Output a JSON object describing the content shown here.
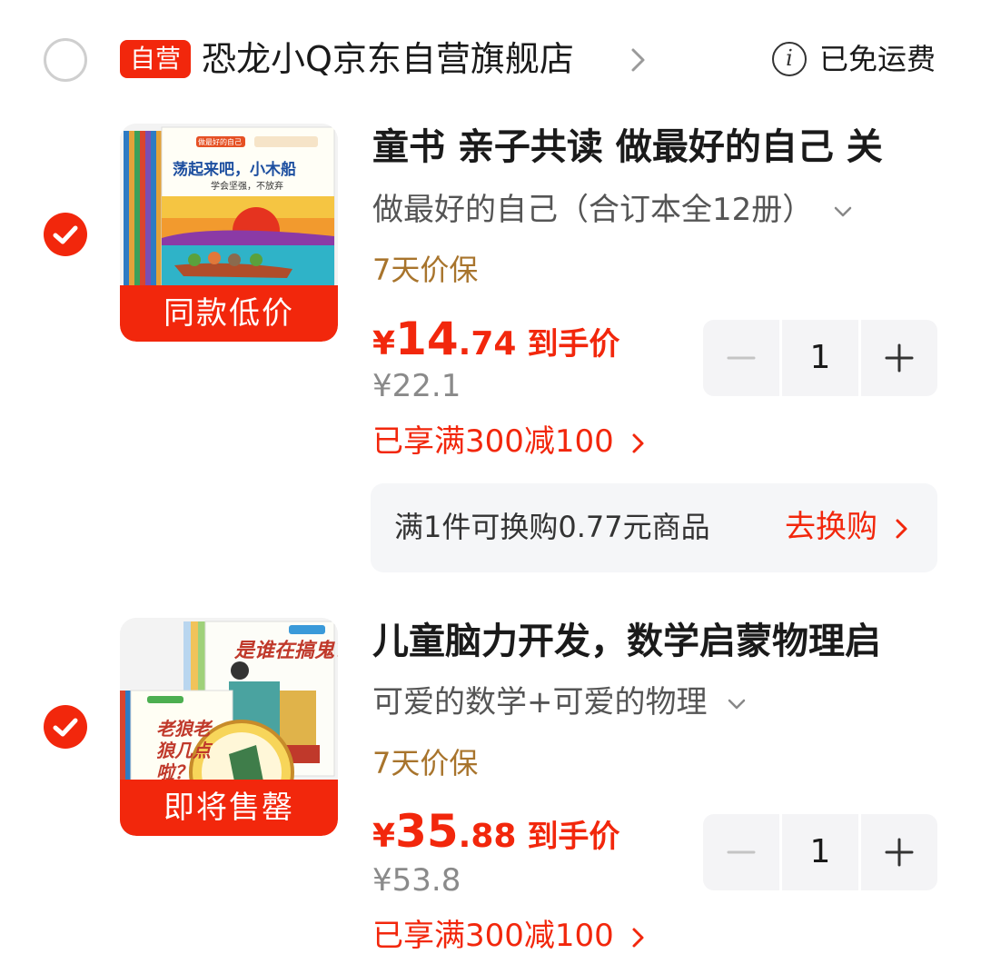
{
  "store": {
    "badge": "自营",
    "name": "恐龙小Q京东自营旗舰店",
    "free_shipping": "已免运费",
    "info_icon": "i"
  },
  "items": [
    {
      "title": "童书 亲子共读 做最好的自己 关",
      "spec": "做最好的自己（合订本全12册）",
      "guarantee": "7天价保",
      "price_symbol": "¥",
      "price_int": "14",
      "price_dec": ".74",
      "price_label": "到手价",
      "original_price": "¥22.1",
      "promo": "已享满300减100",
      "quantity": "1",
      "image_tag": "同款低价",
      "cover_title": "荡起来吧，小木船",
      "cover_subtitle": "学会坚强，不放弃",
      "cover_series": "做最好的自己",
      "checked": true
    },
    {
      "title": "儿童脑力开发，数学启蒙物理启",
      "spec": "可爱的数学+可爱的物理",
      "guarantee": "7天价保",
      "price_symbol": "¥",
      "price_int": "35",
      "price_dec": ".88",
      "price_label": "到手价",
      "original_price": "¥53.8",
      "promo": "已享满300减100",
      "quantity": "1",
      "image_tag": "即将售罄",
      "cover_title_a": "是谁在搞鬼？",
      "cover_title_b": "老狼老狼几点啦？",
      "checked": true
    }
  ],
  "exchange": {
    "text": "满1件可换购0.77元商品",
    "action": "去换购"
  },
  "colors": {
    "brand_red": "#f2270c",
    "guarantee_gold": "#a8742c",
    "muted": "#8a8a8a",
    "stepper_bg": "#f4f4f6"
  },
  "icons": {
    "store_chevron": "chevron-right-icon",
    "info": "info-icon",
    "check": "check-circle-icon",
    "spec_chevron": "chevron-down-icon",
    "minus": "minus-icon",
    "plus": "plus-icon"
  }
}
